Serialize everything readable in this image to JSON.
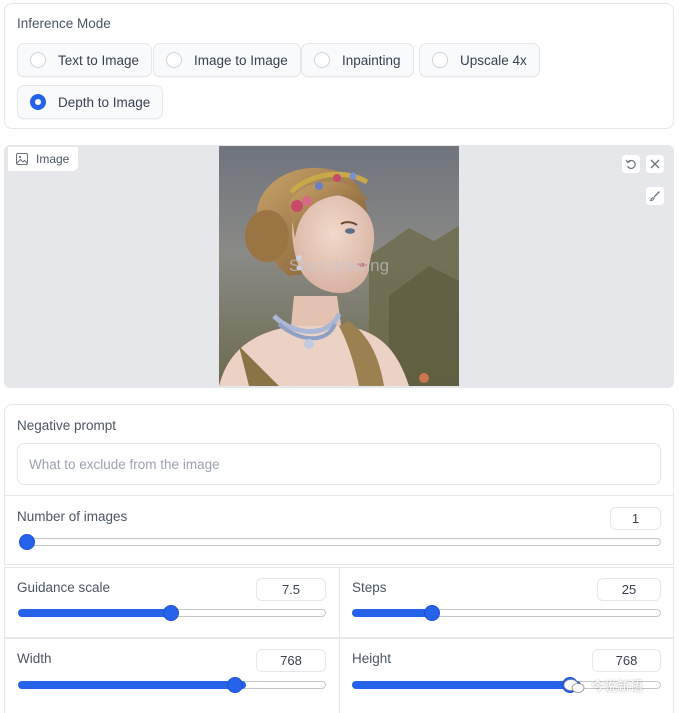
{
  "inference_mode": {
    "label": "Inference Mode",
    "options": [
      "Text to Image",
      "Image to Image",
      "Inpainting",
      "Upscale 4x",
      "Depth to Image"
    ],
    "selected": "Depth to Image"
  },
  "image_input": {
    "label": "Image",
    "overlay_text": "Start drawing",
    "tools": [
      "undo-icon",
      "close-icon",
      "brush-icon"
    ]
  },
  "negative_prompt": {
    "label": "Negative prompt",
    "placeholder": "What to exclude from the image",
    "value": ""
  },
  "num_images": {
    "label": "Number of images",
    "value": "1",
    "min": 1,
    "max": 4,
    "fraction": 0.0
  },
  "guidance_scale": {
    "label": "Guidance scale",
    "value": "7.5",
    "fraction": 0.5
  },
  "steps": {
    "label": "Steps",
    "value": "25",
    "fraction": 0.25
  },
  "width": {
    "label": "Width",
    "value": "768",
    "fraction": 0.72
  },
  "height": {
    "label": "Height",
    "value": "768",
    "fraction": 0.72
  },
  "watermark": {
    "text": "今说新语"
  },
  "colors": {
    "accent": "#2563eb",
    "border": "#e5e7eb",
    "panel_bg": "#e5e7eb"
  }
}
